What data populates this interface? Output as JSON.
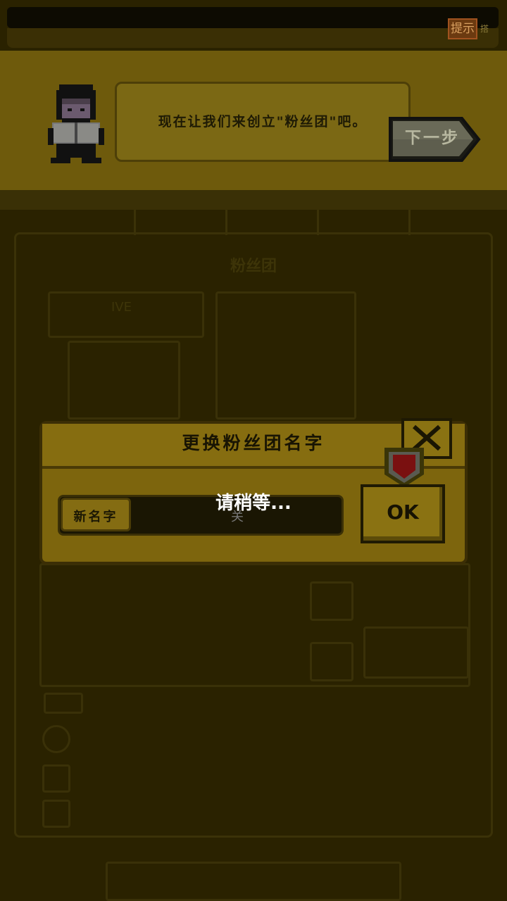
{
  "top_bar": {
    "hint_label": "提示",
    "hint_extra": "搭"
  },
  "tutorial": {
    "message": "现在让我们来创立\"粉丝团\"吧。",
    "next_label": "下一步"
  },
  "background": {
    "panel_title": "粉丝团",
    "live_label": "IVE",
    "fan_icon_label": "关"
  },
  "dialog": {
    "title": "更换粉丝团名字",
    "name_label": "新名字",
    "name_placeholder": "关",
    "ok_label": "OK",
    "loading_text": "请稍等..."
  },
  "colors": {
    "banner": "#6e5a0c",
    "dialog": "#7d650d",
    "heart": "#7a1010",
    "overlay": "#2a2200"
  }
}
